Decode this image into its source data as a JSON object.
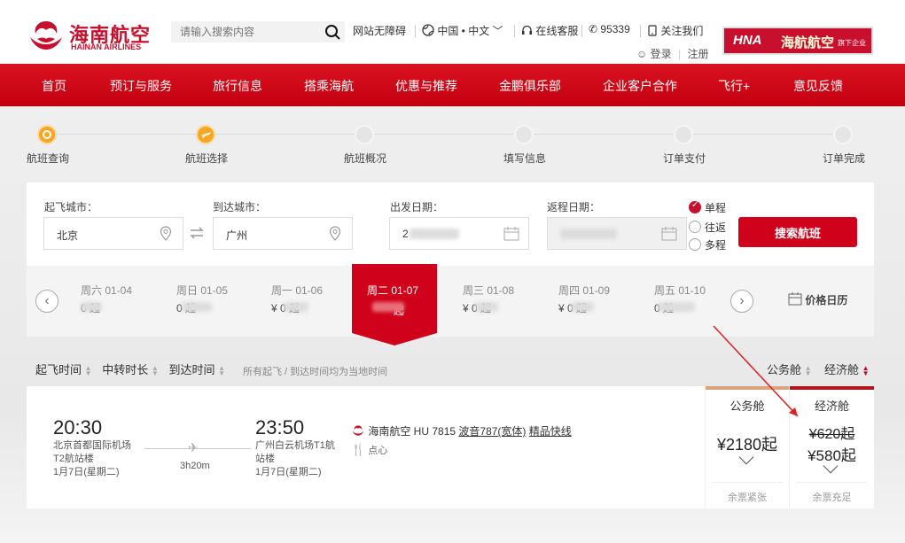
{
  "header": {
    "logo_cn": "海南航空",
    "logo_en": "HAINAN AIRLINES",
    "search_placeholder": "请输入搜索内容",
    "links": [
      "网站无障碍",
      "中国 • 中文",
      "在线客服",
      "95339",
      "关注我们"
    ],
    "login": "登录",
    "register": "注册",
    "hna_logo": "HNA",
    "hna_cn": "海航航空",
    "hna_sub": "旗下企业"
  },
  "nav": [
    "首页",
    "预订与服务",
    "旅行信息",
    "搭乘海航",
    "优惠与推荐",
    "金鹏俱乐部",
    "企业客户合作",
    "飞行+",
    "意见反馈"
  ],
  "steps": [
    "航班查询",
    "航班选择",
    "航班概况",
    "填写信息",
    "订单支付",
    "订单完成"
  ],
  "form": {
    "from_label": "起飞城市：",
    "from_value": "北京",
    "to_label": "到达城市：",
    "to_value": "广州",
    "depart_label": "出发日期：",
    "depart_value": "2",
    "return_label": "返程日期：",
    "trip_types": [
      "单程",
      "往返",
      "多程"
    ],
    "search_button": "搜索航班"
  },
  "dates": [
    {
      "day": "周六 01-04",
      "price": "0 起"
    },
    {
      "day": "周日 01-05",
      "price": "0 起"
    },
    {
      "day": "周一 01-06",
      "price": "¥ 0 起"
    },
    {
      "day": "周二 01-07",
      "price": "起"
    },
    {
      "day": "周三 01-08",
      "price": "¥ 0 起"
    },
    {
      "day": "周四 01-09",
      "price": "¥ 0 起"
    },
    {
      "day": "周五 01-10",
      "price": "0 起"
    }
  ],
  "price_calendar": "价格日历",
  "sort": {
    "depart_time": "起飞时间",
    "transfer": "中转时长",
    "arrive_time": "到达时间",
    "note": "所有起飞 / 到达时间均为当地时间",
    "business": "公务舱",
    "economy": "经济舱"
  },
  "flight": {
    "dep_time": "20:30",
    "dep_airport": "北京首都国际机场",
    "dep_terminal": "T2航站楼",
    "dep_date": "1月7日(星期二)",
    "duration": "3h20m",
    "arr_time": "23:50",
    "arr_airport": "广州白云机场T1航",
    "arr_terminal": "站楼",
    "arr_date": "1月7日(星期二)",
    "airline": "海南航空 HU 7815",
    "aircraft": "波音787(宽体)",
    "route_tag": "精品快线",
    "meal": "点心",
    "business_title": "公务舱",
    "business_price": "¥2180起",
    "business_status": "余票紧张",
    "economy_title": "经济舱",
    "economy_old_price": "¥620起",
    "economy_price": "¥580起",
    "economy_status": "余票充足"
  },
  "colors": {
    "brand_red": "#d0021b",
    "step_active": "#f5a623"
  }
}
